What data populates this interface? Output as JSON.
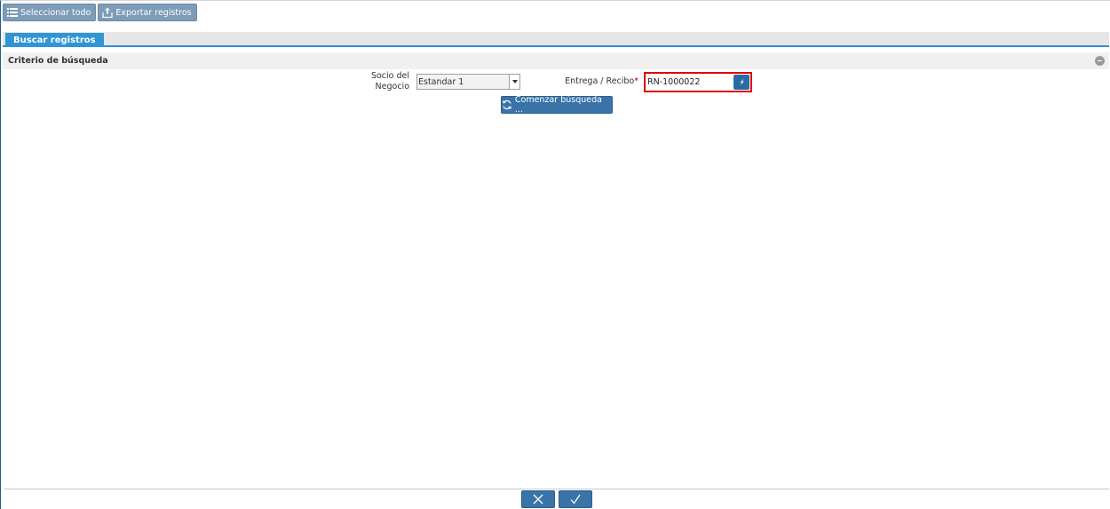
{
  "toolbar": {
    "select_all_label": "Seleccionar todo",
    "export_label": "Exportar registros",
    "select_all_icon": "list-icon",
    "export_icon": "export-icon"
  },
  "tabs": [
    {
      "label": "Buscar registros",
      "active": true
    }
  ],
  "criteria": {
    "title": "Criterio de búsqueda",
    "toggle_icon": "collapse-icon"
  },
  "form": {
    "business_partner": {
      "label_line1": "Socio del",
      "label_line2": "Negocio",
      "value": "Estandar 1"
    },
    "delivery_receipt": {
      "label": "Entrega / Recibo",
      "required_mark": "*",
      "value": "RN-1000022",
      "lookup_icon": "lookup-icon"
    },
    "start_search_label": "Comenzar búsqueda ...",
    "start_search_icon": "refresh-icon"
  },
  "footer": {
    "cancel_icon": "close-icon",
    "ok_icon": "checkmark-icon"
  },
  "colors": {
    "accent": "#2f95d6",
    "button": "#3a73a8",
    "toolbar_button": "#7d9cb8",
    "highlight": "#e00000"
  }
}
